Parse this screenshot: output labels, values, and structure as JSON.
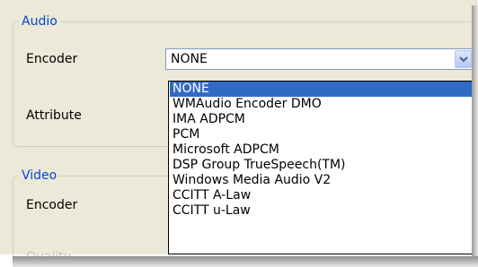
{
  "audio": {
    "group_title": "Audio",
    "encoder_label": "Encoder",
    "attribute_label": "Attribute",
    "encoder_selected": "NONE",
    "encoder_options": [
      "NONE",
      "WMAudio Encoder DMO",
      "IMA ADPCM",
      "PCM",
      "Microsoft ADPCM",
      "DSP Group TrueSpeech(TM)",
      "Windows Media Audio V2",
      "CCITT A-Law",
      "CCITT u-Law"
    ],
    "highlighted_option": "NONE"
  },
  "video": {
    "group_title": "Video",
    "encoder_label": "Encoder",
    "quality_label": "Quality"
  },
  "colors": {
    "group_title": "#0046d5",
    "highlight": "#316ac5",
    "panel": "#ece9d8"
  },
  "icons": {
    "dropdown_arrow": "chevron-down-icon"
  }
}
